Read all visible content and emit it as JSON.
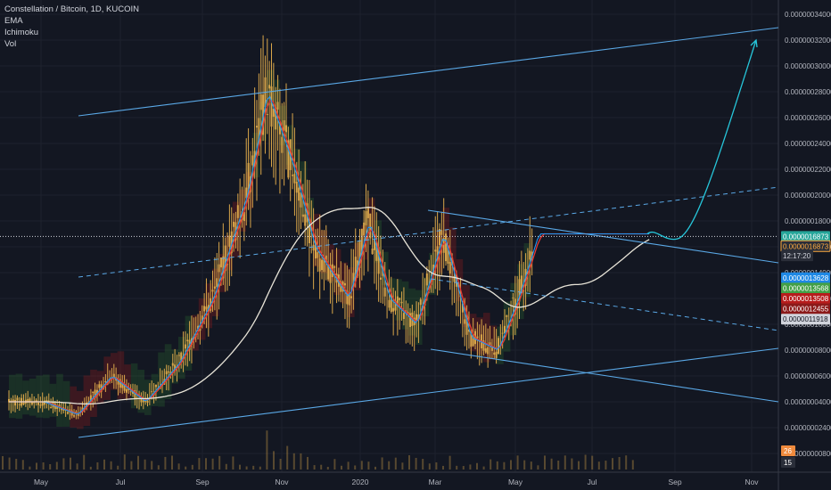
{
  "legend": {
    "title": "Constellation / Bitcoin, 1D, KUCOIN",
    "indicators": [
      "EMA",
      "Ichimoku",
      "Vol"
    ]
  },
  "colors": {
    "background": "#131722",
    "grid": "#1e222d",
    "channel": "#5aa8e6",
    "ema_red": "#e53935",
    "ema_blue": "#2196f3",
    "ma_white": "#e8e4d8",
    "candle": "#d9a64a",
    "cloud_green": "#2e7d32",
    "cloud_red": "#b71c1c",
    "projection": "#26c6da"
  },
  "chart_data": {
    "type": "line",
    "title": "Constellation / Bitcoin, 1D, KUCOIN",
    "ylim": [
      2e-07,
      3.4e-06
    ],
    "y_ticks": [
      "0.00000034000",
      "0.00000032000",
      "0.00000030000",
      "0.00000028000",
      "0.00000026000",
      "0.00000024000",
      "0.00000022000",
      "0.00000020000",
      "0.00000018000",
      "0.00000016000",
      "0.00000014000",
      "0.00000012000",
      "0.00000010000",
      "0.00000008000",
      "0.00000006000",
      "0.00000004000",
      "0.00000002400",
      "0.00000000800"
    ],
    "x_ticks": [
      "May",
      "Jul",
      "Sep",
      "Nov",
      "2020",
      "Mar",
      "May",
      "Jul",
      "Sep",
      "Nov"
    ],
    "last_price": "0.0000016873",
    "badges": [
      {
        "label": "0.0000016873",
        "value": 1.68e-06,
        "bg": "#26a69a",
        "fg": "#ffffff"
      },
      {
        "label": "0.0000016873",
        "value": 1.605e-06,
        "bg": "#2a2e39",
        "fg": "#ffab40",
        "border": "#ffab40"
      },
      {
        "label": "12:17:20",
        "value": 1.53e-06,
        "bg": "#2a2e39",
        "fg": "#d1d4dc"
      },
      {
        "label": "0.0000013628",
        "value": 1.36e-06,
        "bg": "#1e88e5",
        "fg": "#ffffff"
      },
      {
        "label": "0.0000013568",
        "value": 1.28e-06,
        "bg": "#43a047",
        "fg": "#ffffff"
      },
      {
        "label": "0.0000013508",
        "value": 1.2e-06,
        "bg": "#b71c1c",
        "fg": "#ffffff"
      },
      {
        "label": "0.0000012455",
        "value": 1.12e-06,
        "bg": "#8b1a1a",
        "fg": "#ffffff"
      },
      {
        "label": "0.0000011918",
        "value": 1.04e-06,
        "bg": "#d1d4dc",
        "fg": "#131722"
      }
    ],
    "volume_badges": [
      {
        "label": "26",
        "bg": "#ef8a3d"
      },
      {
        "label": "15",
        "bg": "#2a2e39"
      }
    ],
    "price_series": [
      {
        "t": 0,
        "v": 4e-07
      },
      {
        "t": 5,
        "v": 4e-07
      },
      {
        "t": 10,
        "v": 3e-07
      },
      {
        "t": 15,
        "v": 6e-07
      },
      {
        "t": 20,
        "v": 4e-07
      },
      {
        "t": 25,
        "v": 7e-07
      },
      {
        "t": 30,
        "v": 1.2e-06
      },
      {
        "t": 35,
        "v": 2e-06
      },
      {
        "t": 38,
        "v": 2.8e-06
      },
      {
        "t": 40,
        "v": 2.5e-06
      },
      {
        "t": 42,
        "v": 2.2e-06
      },
      {
        "t": 45,
        "v": 1.6e-06
      },
      {
        "t": 50,
        "v": 1.2e-06
      },
      {
        "t": 53,
        "v": 1.8e-06
      },
      {
        "t": 56,
        "v": 1.2e-06
      },
      {
        "t": 60,
        "v": 1e-06
      },
      {
        "t": 64,
        "v": 1.7e-06
      },
      {
        "t": 68,
        "v": 9e-07
      },
      {
        "t": 72,
        "v": 8e-07
      },
      {
        "t": 75,
        "v": 1.2e-06
      },
      {
        "t": 78,
        "v": 1.7e-06
      }
    ],
    "projection": {
      "from": 1.7e-06,
      "to": 3.2e-06
    }
  }
}
